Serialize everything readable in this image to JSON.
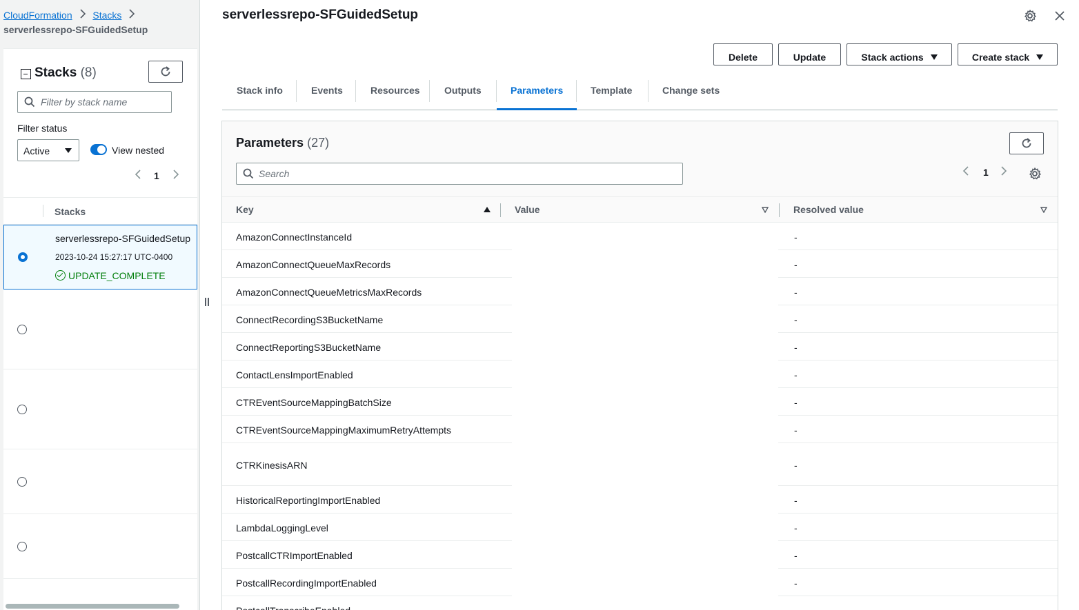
{
  "breadcrumb": {
    "root": "CloudFormation",
    "stacks": "Stacks",
    "current": "serverlessrepo-SFGuidedSetup"
  },
  "stacks_panel": {
    "title": "Stacks",
    "count": "(8)",
    "filter_placeholder": "Filter by stack name",
    "filter_status_label": "Filter status",
    "filter_status_value": "Active",
    "view_nested_label": "View nested",
    "view_nested_on": true,
    "page": "1",
    "column_header": "Stacks",
    "rows": [
      {
        "name": "serverlessrepo-SFGuidedSetup",
        "date": "2023-10-24 15:27:17 UTC-0400",
        "status": "UPDATE_COMPLETE",
        "selected": true
      },
      {
        "name": "",
        "date": "",
        "status": "",
        "selected": false
      },
      {
        "name": "",
        "date": "",
        "status": "",
        "selected": false
      },
      {
        "name": "",
        "date": "",
        "status": "",
        "selected": false
      },
      {
        "name": "",
        "date": "",
        "status": "",
        "selected": false
      }
    ]
  },
  "main": {
    "title": "serverlessrepo-SFGuidedSetup",
    "buttons": {
      "delete": "Delete",
      "update": "Update",
      "stack_actions": "Stack actions",
      "create_stack": "Create stack"
    },
    "tabs": [
      {
        "label": "Stack info",
        "active": false
      },
      {
        "label": "Events",
        "active": false
      },
      {
        "label": "Resources",
        "active": false
      },
      {
        "label": "Outputs",
        "active": false
      },
      {
        "label": "Parameters",
        "active": true
      },
      {
        "label": "Template",
        "active": false
      },
      {
        "label": "Change sets",
        "active": false
      }
    ]
  },
  "parameters": {
    "title": "Parameters",
    "count": "(27)",
    "search_placeholder": "Search",
    "page": "1",
    "columns": {
      "key": "Key",
      "value": "Value",
      "resolved": "Resolved value"
    },
    "rows": [
      {
        "key": "AmazonConnectInstanceId",
        "value": "",
        "resolved": "-"
      },
      {
        "key": "AmazonConnectQueueMaxRecords",
        "value": "",
        "resolved": "-"
      },
      {
        "key": "AmazonConnectQueueMetricsMaxRecords",
        "value": "",
        "resolved": "-"
      },
      {
        "key": "ConnectRecordingS3BucketName",
        "value": "",
        "resolved": "-"
      },
      {
        "key": "ConnectReportingS3BucketName",
        "value": "",
        "resolved": "-"
      },
      {
        "key": "ContactLensImportEnabled",
        "value": "",
        "resolved": "-"
      },
      {
        "key": "CTREventSourceMappingBatchSize",
        "value": "",
        "resolved": "-"
      },
      {
        "key": "CTREventSourceMappingMaximumRetryAttempts",
        "value": "",
        "resolved": "-"
      },
      {
        "key": "CTRKinesisARN",
        "value": "",
        "resolved": "-"
      },
      {
        "key": "HistoricalReportingImportEnabled",
        "value": "",
        "resolved": "-"
      },
      {
        "key": "LambdaLoggingLevel",
        "value": "",
        "resolved": "-"
      },
      {
        "key": "PostcallCTRImportEnabled",
        "value": "",
        "resolved": "-"
      },
      {
        "key": "PostcallRecordingImportEnabled",
        "value": "",
        "resolved": "-"
      },
      {
        "key": "PostcallTranscribeEnabled",
        "value": "",
        "resolved": "-"
      }
    ]
  },
  "colors": {
    "accent": "#0972d3",
    "success": "#037f0c",
    "text": "#16191f",
    "muted": "#545b64"
  },
  "icons": [
    "chevron-right-icon",
    "refresh-icon",
    "search-icon",
    "caret-down-icon",
    "settings-icon",
    "close-icon",
    "check-circle-icon",
    "sort-ascending-icon",
    "sort-icon"
  ]
}
